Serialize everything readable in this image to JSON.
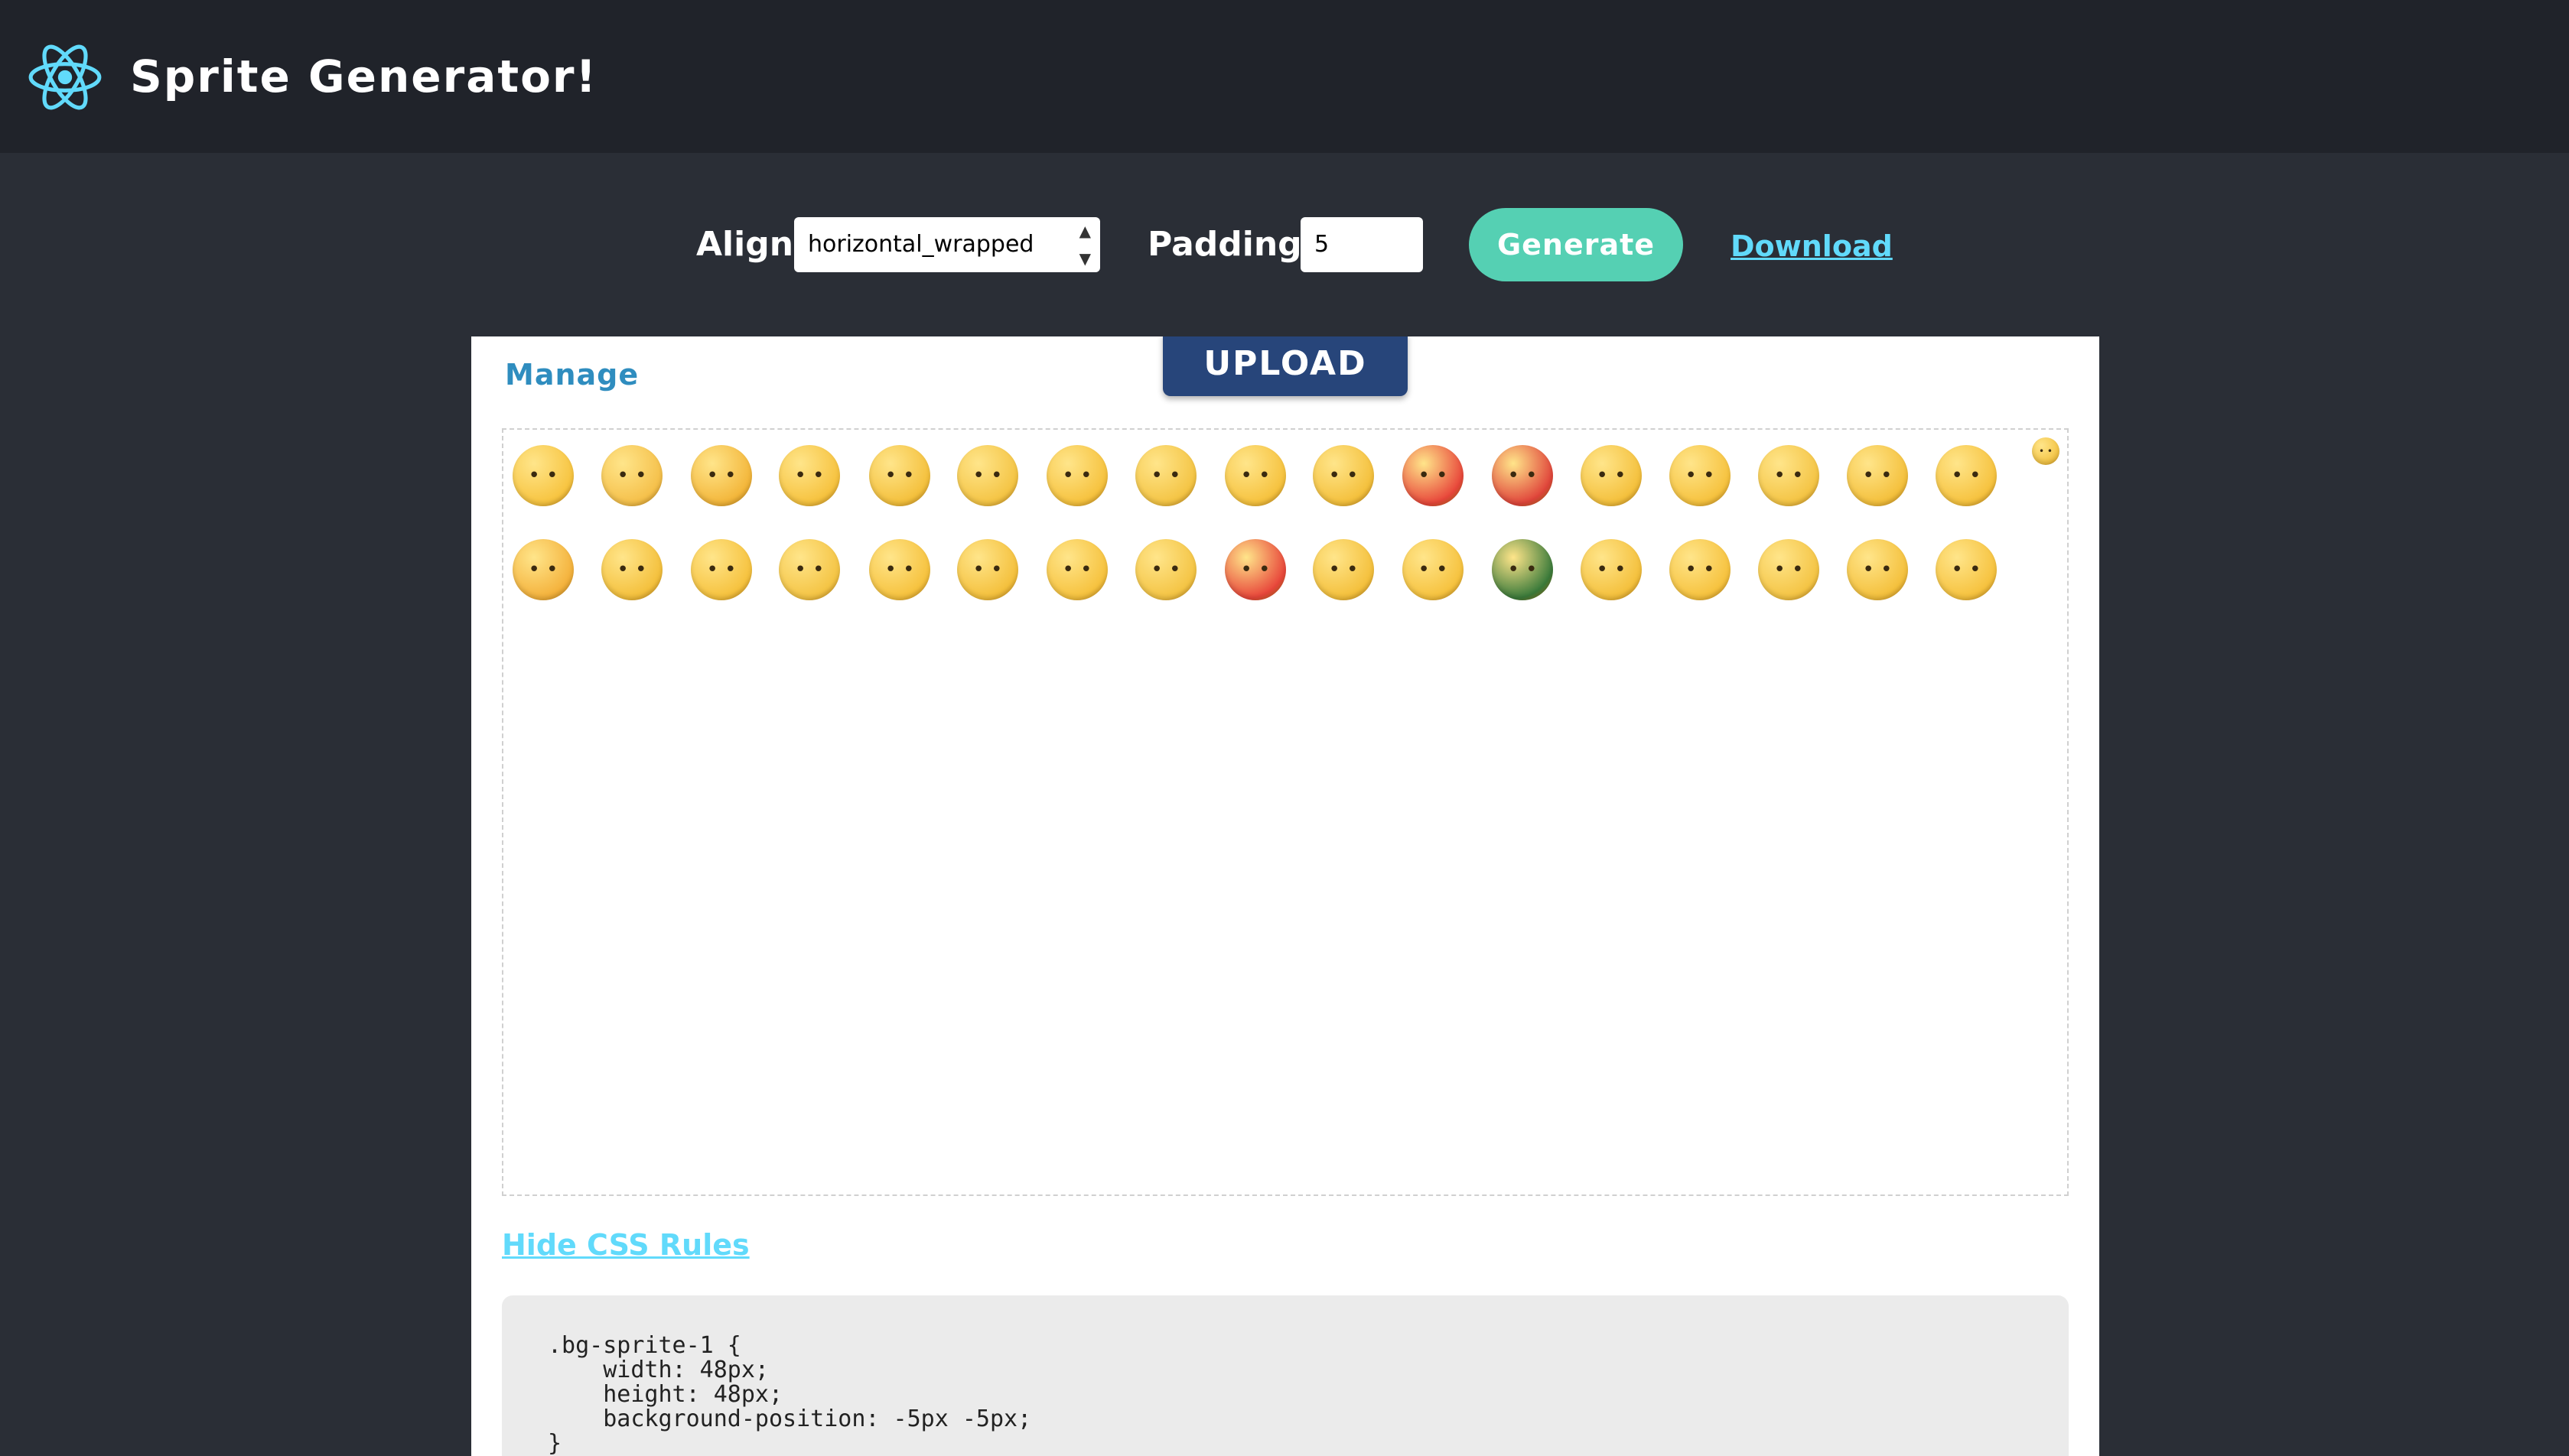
{
  "header": {
    "title": "Sprite Generator!",
    "logo_icon": "react-atom-icon"
  },
  "controls": {
    "align_label": "Align",
    "align_value": "horizontal_wrapped",
    "padding_label": "Padding",
    "padding_value": "5",
    "generate_label": "Generate",
    "download_label": "Download"
  },
  "panel": {
    "upload_label": "UPLOAD",
    "manage_label": "Manage",
    "css_toggle_label": "Hide CSS Rules",
    "css_code": ".bg-sprite-1 {\n    width: 48px;\n    height: 48px;\n    background-position: -5px -5px;\n}"
  },
  "sprites": [
    {
      "icon": "astonished-face-icon"
    },
    {
      "icon": "pleading-face-icon"
    },
    {
      "icon": "heart-eyes-face-icon"
    },
    {
      "icon": "shocked-face-icon"
    },
    {
      "icon": "sunglasses-face-icon"
    },
    {
      "icon": "crying-face-icon"
    },
    {
      "icon": "smiling-eyes-face-icon"
    },
    {
      "icon": "zipped-mouth-face-icon"
    },
    {
      "icon": "sleepy-face-icon"
    },
    {
      "icon": "squinting-face-icon"
    },
    {
      "icon": "dizzy-red-face-icon"
    },
    {
      "icon": "angry-face-icon"
    },
    {
      "icon": "winking-tongue-face-icon"
    },
    {
      "icon": "grinning-face-icon"
    },
    {
      "icon": "smiling-face-icon"
    },
    {
      "icon": "frowning-face-icon"
    },
    {
      "icon": "cool-face-icon"
    },
    {
      "icon": "small-face-icon"
    },
    {
      "icon": "laughing-face-icon"
    },
    {
      "icon": "worried-face-icon"
    },
    {
      "icon": "thinking-face-icon"
    },
    {
      "icon": "blushing-face-icon"
    },
    {
      "icon": "surprised-face-icon"
    },
    {
      "icon": "confused-face-icon"
    },
    {
      "icon": "smirking-face-icon"
    },
    {
      "icon": "neutral-face-icon"
    },
    {
      "icon": "raging-face-icon"
    },
    {
      "icon": "sweating-face-icon"
    },
    {
      "icon": "beaming-face-icon"
    },
    {
      "icon": "turtle-icon"
    },
    {
      "icon": "ninja-face-icon"
    },
    {
      "icon": "tongue-out-face-icon"
    },
    {
      "icon": "question-face-icon"
    },
    {
      "icon": "shushing-face-icon"
    },
    {
      "icon": "dizzy-eyes-face-icon"
    }
  ]
}
